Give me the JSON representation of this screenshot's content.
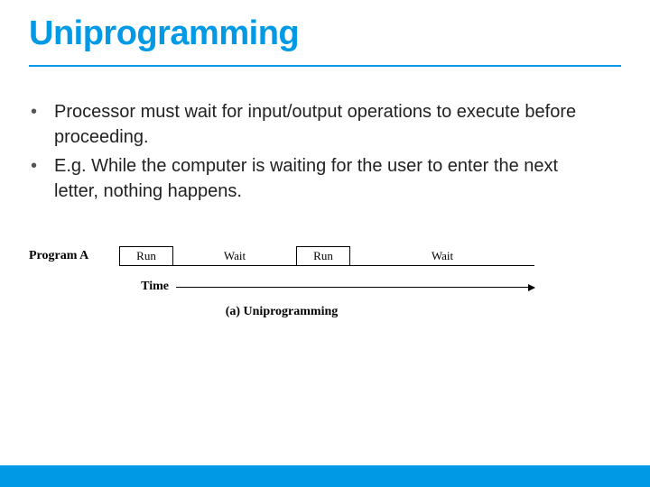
{
  "title": "Uniprogramming",
  "bullets": [
    "Processor must wait for input/output operations to execute before proceeding.",
    "E.g. While the computer is waiting for the user to enter the next letter, nothing happens."
  ],
  "figure": {
    "program_label": "Program A",
    "segments": [
      "Run",
      "Wait",
      "Run",
      "Wait"
    ],
    "time_label": "Time",
    "caption": "(a) Uniprogramming"
  },
  "colors": {
    "accent": "#0099e6"
  }
}
